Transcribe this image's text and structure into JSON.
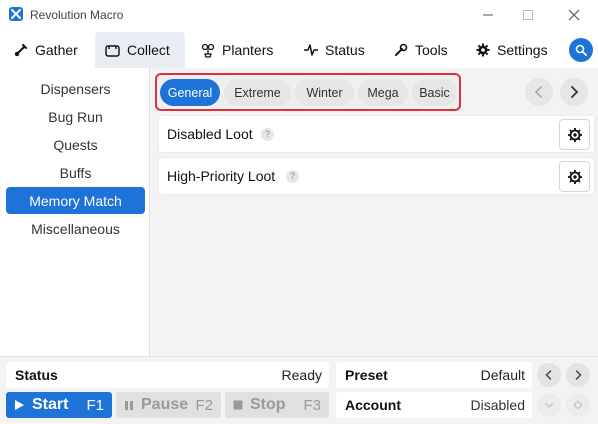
{
  "app": {
    "title": "Revolution Macro",
    "accent_color": "#1e73d8",
    "highlight_color": "#d9313e"
  },
  "tabs": [
    {
      "label": "Gather",
      "icon": "shovel-icon",
      "active": false
    },
    {
      "label": "Collect",
      "icon": "collect-icon",
      "active": true
    },
    {
      "label": "Planters",
      "icon": "planter-icon",
      "active": false
    },
    {
      "label": "Status",
      "icon": "pulse-icon",
      "active": false
    },
    {
      "label": "Tools",
      "icon": "wrench-icon",
      "active": false
    },
    {
      "label": "Settings",
      "icon": "gear-icon",
      "active": false
    }
  ],
  "sidebar": {
    "items": [
      {
        "label": "Dispensers",
        "active": false
      },
      {
        "label": "Bug Run",
        "active": false
      },
      {
        "label": "Quests",
        "active": false
      },
      {
        "label": "Buffs",
        "active": false
      },
      {
        "label": "Memory Match",
        "active": true
      },
      {
        "label": "Miscellaneous",
        "active": false
      }
    ]
  },
  "main": {
    "subtabs": [
      {
        "label": "General",
        "active": true
      },
      {
        "label": "Extreme",
        "active": false
      },
      {
        "label": "Winter",
        "active": false
      },
      {
        "label": "Mega",
        "active": false
      },
      {
        "label": "Basic",
        "active": false
      }
    ],
    "rows": [
      {
        "label": "Disabled Loot",
        "help": "?"
      },
      {
        "label": "High-Priority Loot",
        "help": "?"
      }
    ]
  },
  "bottom": {
    "status_label": "Status",
    "status_value": "Ready",
    "preset_label": "Preset",
    "preset_value": "Default",
    "account_label": "Account",
    "account_value": "Disabled",
    "start_label": "Start",
    "start_key": "F1",
    "pause_label": "Pause",
    "pause_key": "F2",
    "stop_label": "Stop",
    "stop_key": "F3"
  }
}
